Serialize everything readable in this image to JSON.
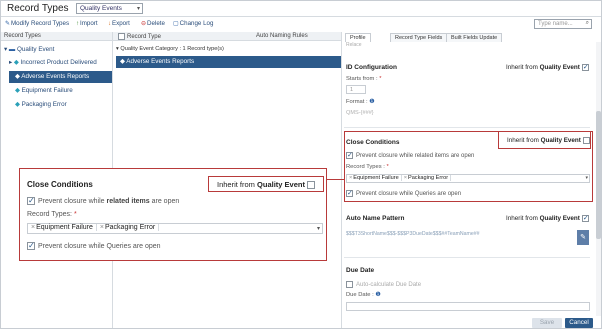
{
  "header": {
    "title": "Record Types",
    "select_value": "Quality Events",
    "search_placeholder": "Type name..."
  },
  "toolbar": {
    "modify": "Modify Record Types",
    "import": "Import",
    "export": "Export",
    "delete": "Delete",
    "changelog": "Change Log"
  },
  "left": {
    "header": "Record Types",
    "items": [
      {
        "label": "Quality Event"
      },
      {
        "label": "Incorrect Product Delivered"
      },
      {
        "label": "Adverse Events Reports"
      },
      {
        "label": "Equipment Failure"
      },
      {
        "label": "Packaging Error"
      }
    ]
  },
  "middle": {
    "col_record_type": "Record Type",
    "col_auto_naming": "Auto Naming Rules",
    "category": "Quality Event Category : 1 Record type(s)",
    "row_label": "Adverse Events Reports"
  },
  "right": {
    "tabs": [
      "Profile",
      "Record Type Fields",
      "Built Fields Update"
    ],
    "truncated_top": "Relace",
    "id_config": {
      "title": "ID Configuration",
      "inherit_prefix": "Inherit from",
      "inherit_source": "Quality Event",
      "starts_from_label": "Starts from :",
      "starts_from_value": "1",
      "format_label": "Format :",
      "format_value": "QMS-{###}"
    },
    "close_conditions": {
      "title": "Close Conditions",
      "inherit_prefix": "Inherit from",
      "inherit_source": "Quality Event",
      "prevent_related": "Prevent closure while related items are open",
      "record_types_label": "Record Types :",
      "tags": [
        "Equipment Failure",
        "Packaging Error"
      ],
      "prevent_queries": "Prevent closure while Queries are open"
    },
    "auto_name": {
      "title": "Auto Name Pattern",
      "inherit_prefix": "Inherit from",
      "inherit_source": "Quality Event",
      "pattern": "$$$T3ShortName$$$-$$$P3DueDate$$$##TeamName##"
    },
    "due_date": {
      "title": "Due Date",
      "auto_calc": "Auto-calculate Due Date",
      "due_date_label": "Due Date :"
    },
    "buttons": {
      "save": "Save",
      "cancel": "Cancel"
    }
  },
  "callout": {
    "title": "Close Conditions",
    "inherit_prefix": "Inherit from",
    "inherit_source": "Quality Event",
    "prevent_related_prefix": "Prevent closure while",
    "prevent_related_bold": "related items",
    "prevent_related_suffix": "are open",
    "record_types_label": "Record Types:",
    "tags": [
      "Equipment Failure",
      "Packaging Error"
    ],
    "prevent_queries": "Prevent closure while Queries are open"
  },
  "colors": {
    "accent": "#2c5a8a",
    "highlight_border": "#b83a3a",
    "link": "#2a4d7a"
  }
}
